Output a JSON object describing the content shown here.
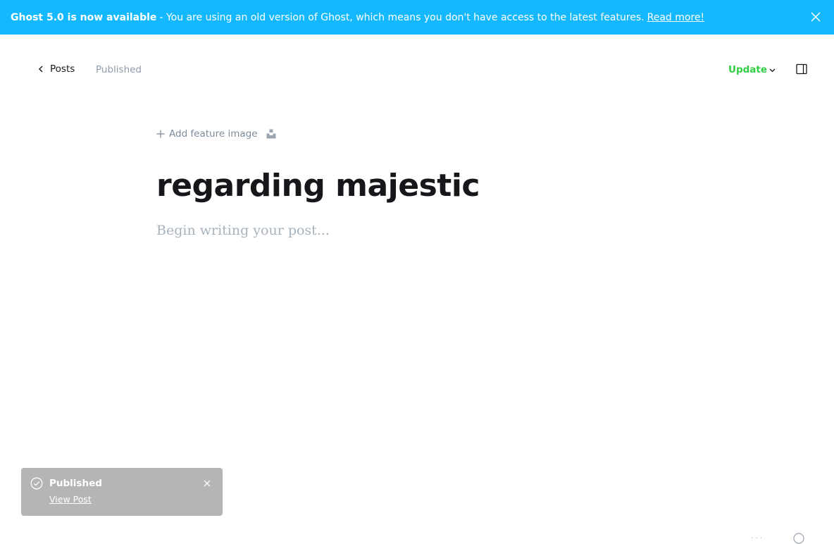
{
  "banner": {
    "title": "Ghost 5.0 is now available",
    "message": "- You are using an old version of Ghost, which means you don't have access to the latest features.",
    "link": "Read more!",
    "bg_color": "#14b8ff",
    "close_icon": "close-icon"
  },
  "header": {
    "back_label": "Posts",
    "status": "Published",
    "update_label": "Update",
    "accent_color": "#30cf43"
  },
  "editor": {
    "add_feature_image": "Add feature image",
    "post_title": "regarding majestic",
    "body_placeholder": "Begin writing your post..."
  },
  "toast": {
    "title": "Published",
    "link": "View Post"
  }
}
